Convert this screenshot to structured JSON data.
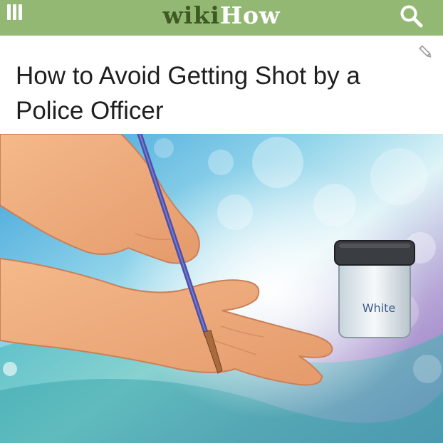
{
  "header": {
    "logo_wiki": "wiki",
    "logo_how": "How",
    "menu_icon": "hamburger-menu-icon",
    "search_icon": "search-icon",
    "bar_color": "#93b874"
  },
  "article": {
    "title": "How to Avoid Getting Shot by a Police Officer",
    "edit_icon": "pencil-edit-icon"
  },
  "illustration": {
    "jar_label": "White"
  }
}
